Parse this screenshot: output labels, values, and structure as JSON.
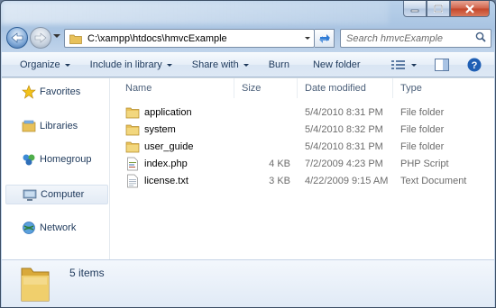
{
  "window": {
    "address_path": "C:\\xampp\\htdocs\\hmvcExample"
  },
  "search": {
    "placeholder": "Search hmvcExample"
  },
  "command_bar": {
    "organize": "Organize",
    "include_in_library": "Include in library",
    "share_with": "Share with",
    "burn": "Burn",
    "new_folder": "New folder"
  },
  "nav_pane": {
    "items": [
      {
        "label": "Favorites",
        "icon": "star-icon"
      },
      {
        "label": "Libraries",
        "icon": "library-icon"
      },
      {
        "label": "Homegroup",
        "icon": "homegroup-icon"
      },
      {
        "label": "Computer",
        "icon": "computer-icon"
      },
      {
        "label": "Network",
        "icon": "network-icon"
      }
    ],
    "selected": "Computer"
  },
  "columns": {
    "name": "Name",
    "size": "Size",
    "date_modified": "Date modified",
    "type": "Type"
  },
  "files": [
    {
      "name": "application",
      "size": "",
      "date": "5/4/2010 8:31 PM",
      "type": "File folder",
      "icon": "folder-icon"
    },
    {
      "name": "system",
      "size": "",
      "date": "5/4/2010 8:32 PM",
      "type": "File folder",
      "icon": "folder-icon"
    },
    {
      "name": "user_guide",
      "size": "",
      "date": "5/4/2010 8:31 PM",
      "type": "File folder",
      "icon": "folder-icon"
    },
    {
      "name": "index.php",
      "size": "4 KB",
      "date": "7/2/2009 4:23 PM",
      "type": "PHP Script",
      "icon": "php-file-icon"
    },
    {
      "name": "license.txt",
      "size": "3 KB",
      "date": "4/22/2009 9:15 AM",
      "type": "Text Document",
      "icon": "text-file-icon"
    }
  ],
  "details": {
    "item_count": "5 items"
  },
  "colors": {
    "accent": "#1e395b",
    "folder": "#e8c15a",
    "chrome": "#b9d1ea"
  }
}
